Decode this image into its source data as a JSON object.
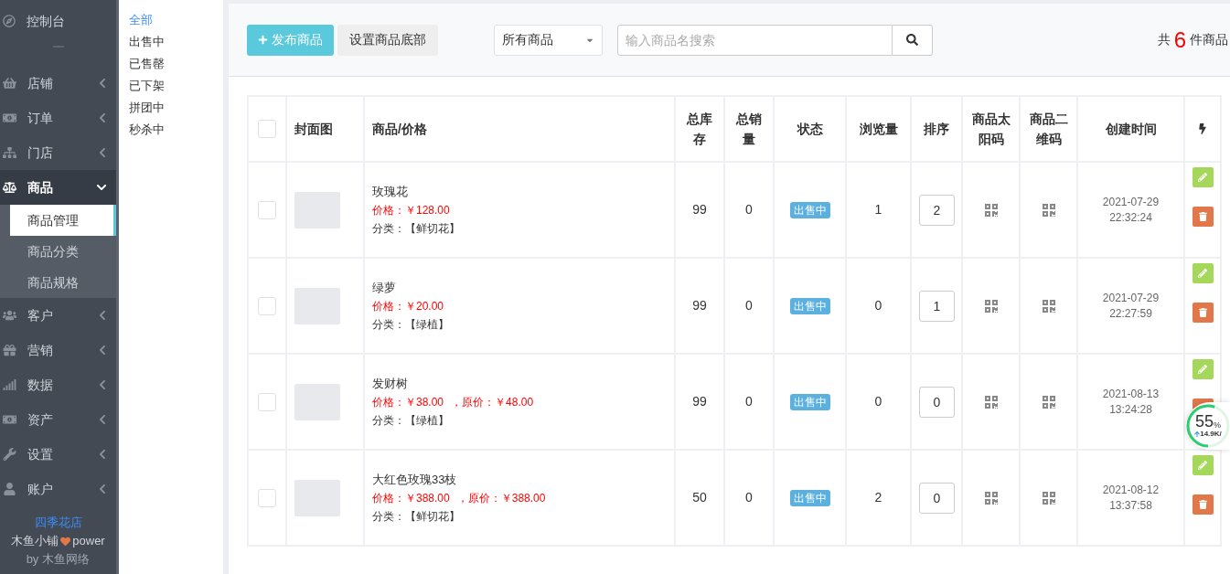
{
  "sidebar": {
    "dashboard": {
      "label": "控制台"
    },
    "menus": [
      {
        "label": "店铺",
        "expanded": false
      },
      {
        "label": "订单",
        "expanded": false
      },
      {
        "label": "门店",
        "expanded": false
      },
      {
        "label": "商品",
        "expanded": true,
        "children": [
          {
            "label": "商品管理",
            "selected": true
          },
          {
            "label": "商品分类",
            "selected": false
          },
          {
            "label": "商品规格",
            "selected": false
          }
        ]
      },
      {
        "label": "客户",
        "expanded": false
      },
      {
        "label": "营销",
        "expanded": false
      },
      {
        "label": "数据",
        "expanded": false
      },
      {
        "label": "资产",
        "expanded": false
      },
      {
        "label": "设置",
        "expanded": false
      },
      {
        "label": "账户",
        "expanded": false
      }
    ],
    "footer": {
      "shop": "四季花店",
      "power": "木鱼小铺",
      "power_suffix": "power",
      "by": "by",
      "company": "木鱼网络"
    }
  },
  "filters": [
    {
      "label": "全部",
      "selected": true
    },
    {
      "label": "出售中",
      "selected": false
    },
    {
      "label": "已售罄",
      "selected": false
    },
    {
      "label": "已下架",
      "selected": false
    },
    {
      "label": "拼团中",
      "selected": false
    },
    {
      "label": "秒杀中",
      "selected": false
    }
  ],
  "toolbar": {
    "publish_button": "发布商品",
    "footer_button": "设置商品底部",
    "category_select": "所有商品",
    "search": {
      "placeholder": "输入商品名搜索"
    },
    "total_prefix": "共",
    "total_count": "6",
    "total_suffix": "件商品"
  },
  "table": {
    "select_all": {
      "checked": false
    },
    "columns": [
      "封面图",
      "商品/价格",
      "总库存",
      "总销量",
      "状态",
      "浏览量",
      "排序",
      "商品太阳码",
      "商品二维码",
      "创建时间"
    ],
    "rows": [
      {
        "checked": false,
        "name": "玫瑰花",
        "price": "价格：￥128.00",
        "category": "分类：【鲜切花】",
        "stock": "99",
        "sales": "0",
        "status": {
          "label": "出售中",
          "kind": "on_sale"
        },
        "views": "1",
        "sort": "2",
        "created_date": "2021-07-29",
        "created_time": "22:32:24"
      },
      {
        "checked": false,
        "name": "绿萝",
        "price": "价格：￥20.00",
        "category": "分类：【绿植】",
        "stock": "99",
        "sales": "0",
        "status": {
          "label": "出售中",
          "kind": "on_sale"
        },
        "views": "0",
        "sort": "1",
        "created_date": "2021-07-29",
        "created_time": "22:27:59"
      },
      {
        "checked": false,
        "name": "发财树",
        "price": "价格：￥38.00",
        "original_price": "，原价：￥48.00",
        "category": "分类：【绿植】",
        "stock": "99",
        "sales": "0",
        "status": {
          "label": "出售中",
          "kind": "on_sale"
        },
        "views": "0",
        "sort": "0",
        "created_date": "2021-08-13",
        "created_time": "13:24:28"
      },
      {
        "checked": false,
        "name": "大红色玫瑰33枝",
        "price": "价格：￥388.00",
        "original_price": "，原价：￥388.00",
        "category": "分类：【鲜切花】",
        "stock": "50",
        "sales": "0",
        "status": {
          "label": "出售中",
          "kind": "on_sale"
        },
        "views": "2",
        "sort": "0",
        "created_date": "2021-08-12",
        "created_time": "13:37:58"
      }
    ]
  },
  "speed_widget": {
    "percent": "55",
    "unit": "%",
    "upload": "14.9K/",
    "level": 0.55
  }
}
